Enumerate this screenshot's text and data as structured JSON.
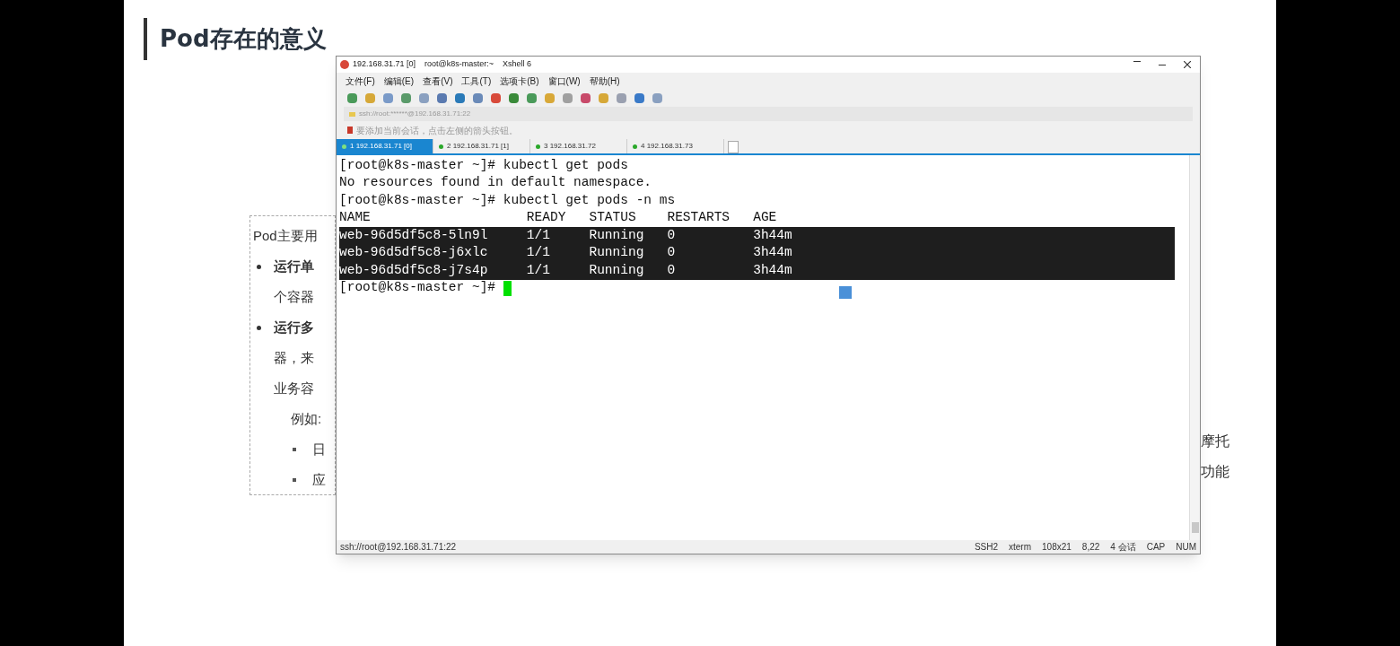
{
  "slide": {
    "title": "Pod存在的意义",
    "text_box": [
      {
        "kind": "plain",
        "text": "Pod主要用"
      },
      {
        "kind": "bullet",
        "text": "运行单",
        "bold": true
      },
      {
        "kind": "indent",
        "text": "个容器"
      },
      {
        "kind": "bullet",
        "text": "运行多",
        "bold": true
      },
      {
        "kind": "indent",
        "text": "器，来"
      },
      {
        "kind": "indent",
        "text": "业务容"
      },
      {
        "kind": "sub",
        "text": "例如:"
      },
      {
        "kind": "subbullet",
        "text": "日"
      },
      {
        "kind": "subbullet",
        "text": "应"
      }
    ],
    "right_fragments": [
      "摩托",
      "功能"
    ]
  },
  "window": {
    "title": "192.168.31.71 [0]    root@k8s-master:~    Xshell 6",
    "menu": [
      "文件(F)",
      "编辑(E)",
      "查看(V)",
      "工具(T)",
      "选项卡(B)",
      "窗口(W)",
      "帮助(H)"
    ],
    "address": "ssh://root:******@192.168.31.71:22",
    "tip": "要添加当前会话，点击左侧的箭头按钮。",
    "tabs": [
      {
        "label": "1 192.168.31.71 [0]",
        "selected": true
      },
      {
        "label": "2 192.168.31.71 [1]",
        "selected": false
      },
      {
        "label": "3 192.168.31.72",
        "selected": false
      },
      {
        "label": "4 192.168.31.73",
        "selected": false
      }
    ],
    "terminal": [
      {
        "text": "[root@k8s-master ~]# kubectl get pods",
        "selected": false
      },
      {
        "text": "No resources found in default namespace.",
        "selected": false
      },
      {
        "text": "[root@k8s-master ~]# kubectl get pods -n ms",
        "selected": false
      },
      {
        "text": "NAME                    READY   STATUS    RESTARTS   AGE",
        "selected": false
      },
      {
        "text": "web-96d5df5c8-5ln9l     1/1     Running   0          3h44m",
        "selected": true
      },
      {
        "text": "web-96d5df5c8-j6xlc     1/1     Running   0          3h44m",
        "selected": true
      },
      {
        "text": "web-96d5df5c8-j7s4p     1/1     Running   0          3h44m",
        "selected": true
      },
      {
        "text": "[root@k8s-master ~]# ",
        "selected": false,
        "cursor": true
      }
    ],
    "status_bar": [
      "ssh://root@192.168.31.71:22",
      "SSH2",
      "xterm",
      "108x21",
      "8,22",
      "4 会话",
      "CAP",
      "NUM"
    ]
  }
}
